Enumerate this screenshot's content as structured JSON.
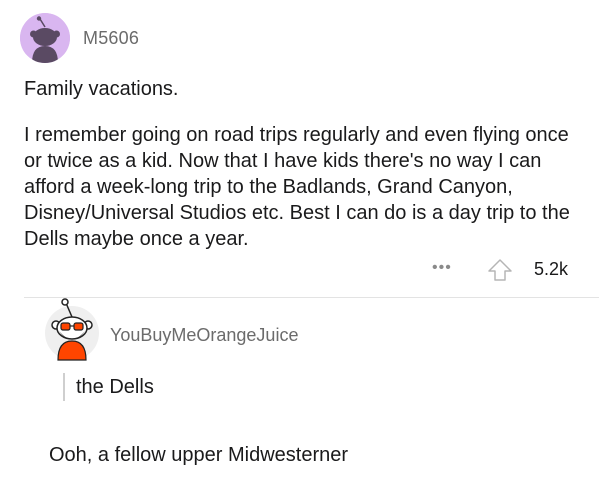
{
  "post": {
    "username": "M5606",
    "title": "Family vacations.",
    "body": "I remember going on road trips regularly and even flying once or twice as a kid. Now that I have kids there's no way I can afford a week-long trip to the Badlands, Grand Canyon, Disney/Universal Studios etc. Best I can do is a day trip to the Dells maybe once a year.",
    "more_icon": "more-horizontal-icon",
    "upvote_icon": "upvote-arrow-icon",
    "vote_count": "5.2k",
    "avatar_color": "#d9b6f0"
  },
  "reply": {
    "username": "YouBuyMeOrangeJuice",
    "quote": "the Dells",
    "text": "Ooh, a fellow upper Midwesterner",
    "avatar_accent": "#ff4500"
  }
}
